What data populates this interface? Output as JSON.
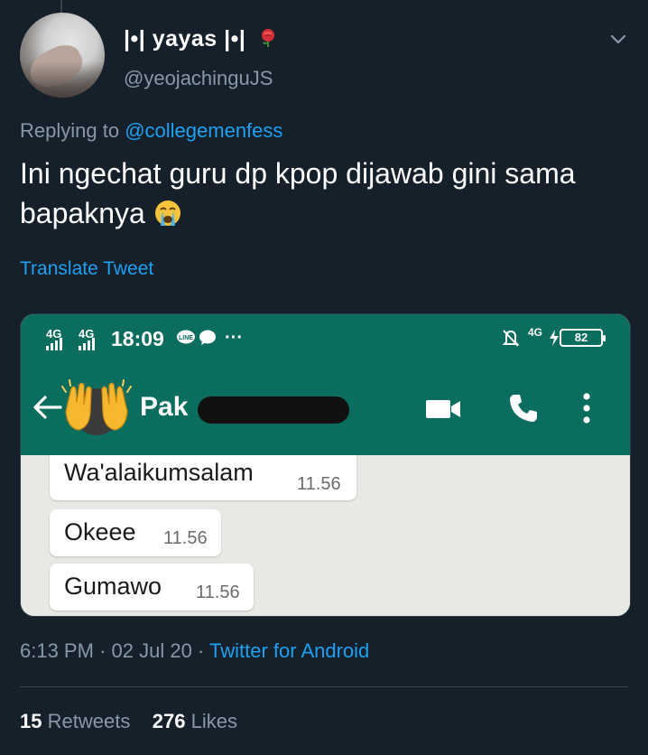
{
  "tweet": {
    "display_name": "|•| yayas |•|",
    "handle": "@yeojachinguJS",
    "replying_prefix": "Replying to",
    "replying_to": "@collegemenfess",
    "text": "Ini ngechat guru dp kpop dijawab gini sama bapaknya",
    "translate_label": "Translate Tweet",
    "time": "6:13 PM",
    "date": "02 Jul 20",
    "source": "Twitter for Android",
    "retweet_count": "15",
    "retweet_label": "Retweets",
    "like_count": "276",
    "like_label": "Likes"
  },
  "screenshot": {
    "status_bar": {
      "net1": "4G",
      "net2": "4G",
      "time": "18:09",
      "more": "···",
      "net3": "4G",
      "battery": "82"
    },
    "chat_header": {
      "contact_name": "Pak"
    },
    "messages": [
      {
        "text": "Wa'alaikumsalam",
        "time": "11.56"
      },
      {
        "text": "Okeee",
        "time": "11.56"
      },
      {
        "text": "Gumawo",
        "time": "11.56"
      }
    ]
  },
  "colors": {
    "background": "#15202b",
    "secondary_text": "#8899a6",
    "link": "#1da1f2",
    "whatsapp_header": "#0b6d5e"
  },
  "icons": [
    "rose-emoji-icon",
    "chevron-down-icon",
    "crying-emoji-icon",
    "back-arrow-icon",
    "video-call-icon",
    "phone-call-icon",
    "more-options-icon"
  ]
}
